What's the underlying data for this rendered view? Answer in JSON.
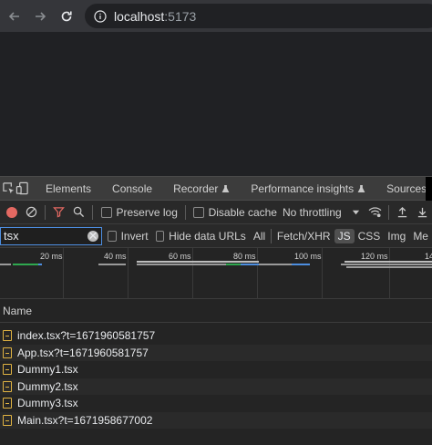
{
  "browser": {
    "url_host": "localhost",
    "url_port": ":5173"
  },
  "devtools": {
    "tabs": [
      "Elements",
      "Console",
      "Recorder",
      "Performance insights",
      "Sources"
    ],
    "toolbar": {
      "preserve_log": "Preserve log",
      "disable_cache": "Disable cache",
      "throttling": "No throttling"
    },
    "filter": {
      "value": "tsx",
      "invert": "Invert",
      "hide_data_urls": "Hide data URLs",
      "types": [
        "All",
        "Fetch/XHR",
        "JS",
        "CSS",
        "Img",
        "Me"
      ],
      "active_type": "JS"
    },
    "timeline_ticks": [
      "20 ms",
      "40 ms",
      "60 ms",
      "80 ms",
      "100 ms",
      "120 ms",
      "14"
    ],
    "name_header": "Name",
    "requests": [
      "index.tsx?t=1671960581757",
      "App.tsx?t=1671960581757",
      "Dummy1.tsx",
      "Dummy2.tsx",
      "Dummy3.tsx",
      "Main.tsx?t=1671958677002"
    ]
  },
  "colors": {
    "accent_blue": "#4d8ee0",
    "record_red": "#e46962",
    "filter_red": "#e46962",
    "js_file": "#e0b342"
  }
}
